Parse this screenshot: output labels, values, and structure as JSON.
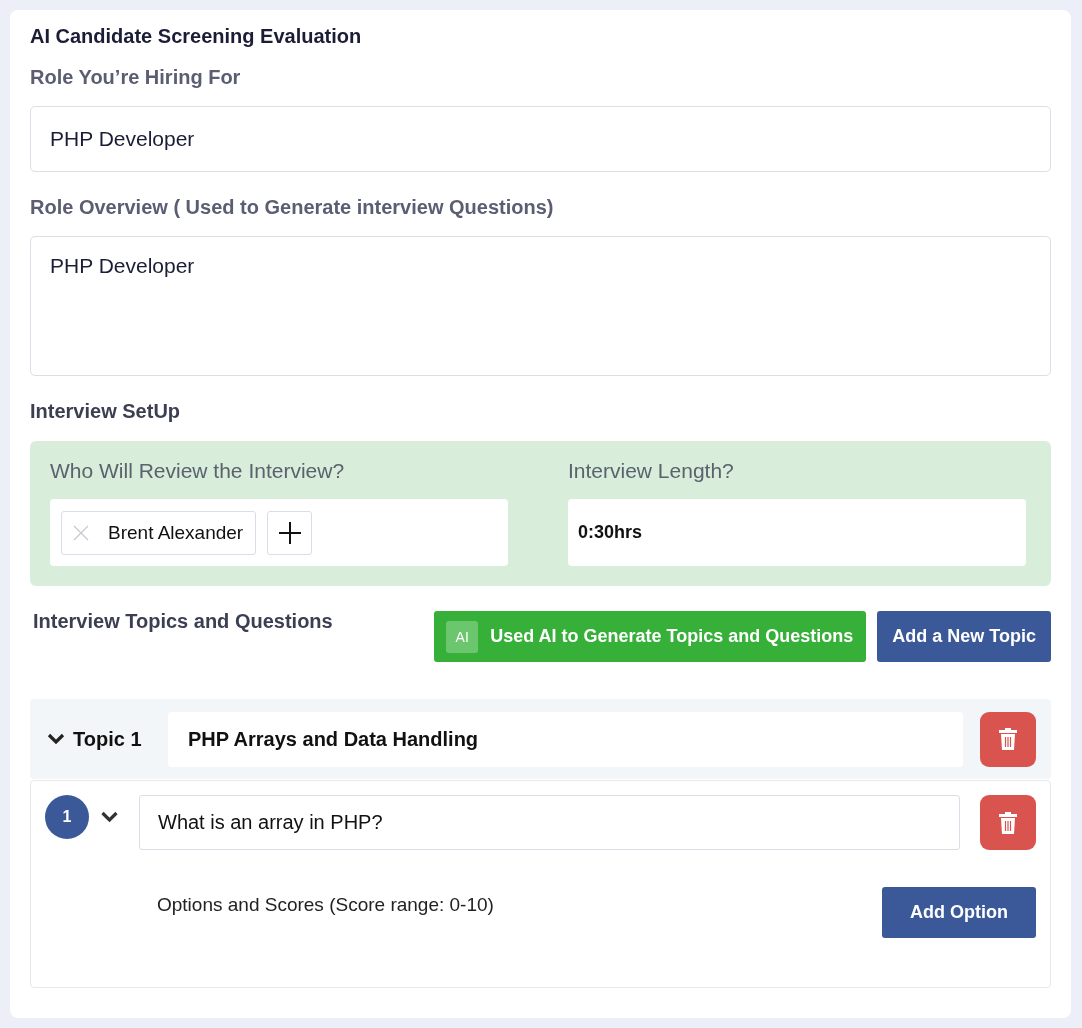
{
  "title": "AI Candidate Screening Evaluation",
  "role": {
    "label": "Role You’re Hiring For",
    "value": "PHP Developer"
  },
  "overview": {
    "label": "Role Overview ( Used to Generate interview Questions)",
    "value": "PHP Developer"
  },
  "setup": {
    "heading": "Interview SetUp",
    "reviewers": {
      "label": "Who Will Review the Interview?",
      "people": [
        {
          "name": "Brent Alexander"
        }
      ]
    },
    "length": {
      "label": "Interview Length?",
      "value": "0:30hrs"
    }
  },
  "topics_section": {
    "heading": "Interview Topics and Questions",
    "buttons": [
      {
        "kind": "ai",
        "badge": "AI",
        "label": "Used AI to Generate Topics and Questions"
      },
      {
        "kind": "primary",
        "label": "Add a New Topic"
      }
    ]
  },
  "topics": [
    {
      "label": "Topic 1",
      "expanded": true,
      "value": "PHP Arrays and Data Handling",
      "questions": [
        {
          "number": "1",
          "expanded": true,
          "value": "What is an array in PHP?",
          "options_label": "Options and Scores (Score range: 0-10)",
          "add_option": "Add Option"
        }
      ]
    }
  ]
}
